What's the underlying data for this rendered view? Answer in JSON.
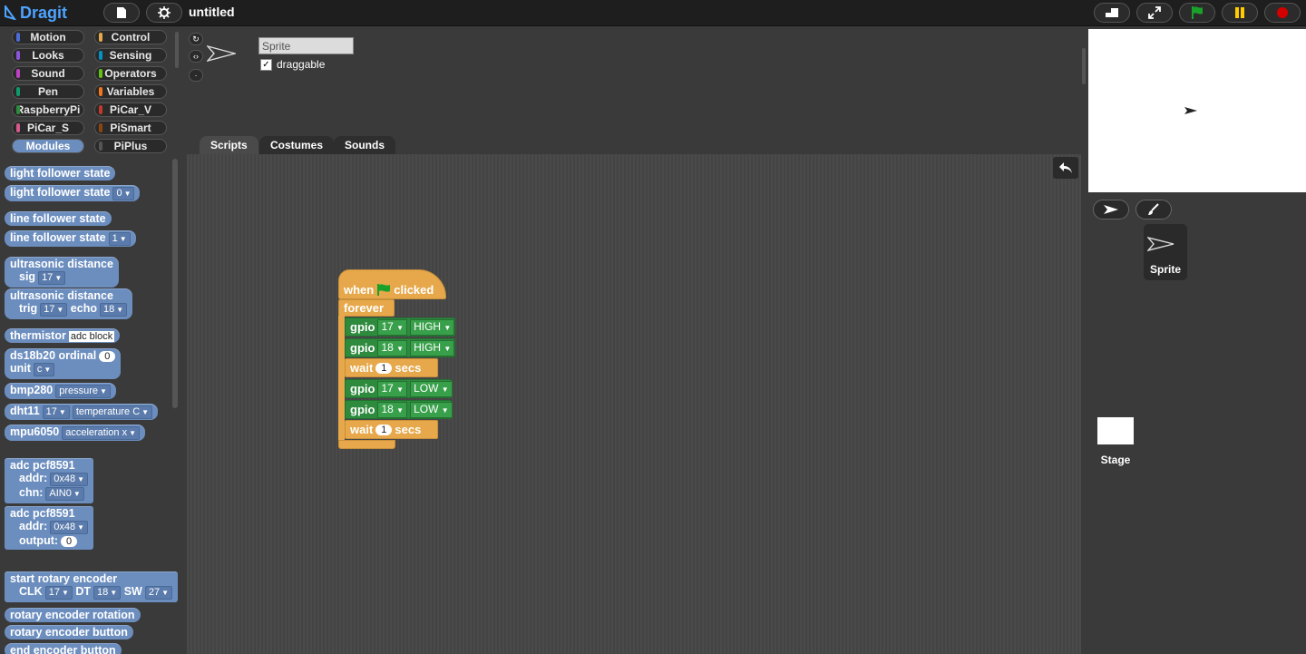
{
  "app": {
    "logo": "Dragit",
    "project_title": "untitled"
  },
  "categories": [
    {
      "label": "Motion",
      "color": "#4a6cd4"
    },
    {
      "label": "Control",
      "color": "#e6a84a"
    },
    {
      "label": "Looks",
      "color": "#8a55d7"
    },
    {
      "label": "Sensing",
      "color": "#0093c4"
    },
    {
      "label": "Sound",
      "color": "#bb42c3"
    },
    {
      "label": "Operators",
      "color": "#62c213"
    },
    {
      "label": "Pen",
      "color": "#0e9a6c"
    },
    {
      "label": "Variables",
      "color": "#f3761d"
    },
    {
      "label": "RaspberryPi",
      "color": "#2e8b3e"
    },
    {
      "label": "PiCar_V",
      "color": "#c0392b"
    },
    {
      "label": "PiCar_S",
      "color": "#d45a8a"
    },
    {
      "label": "PiSmart",
      "color": "#8b4513"
    },
    {
      "label": "Modules",
      "color": "#6c8ebf"
    },
    {
      "label": "PiPlus",
      "color": "#555555"
    }
  ],
  "palette": {
    "light_follower_state": "light follower state",
    "light_follower_state_n": "light follower state",
    "light_follower_n_val": "0",
    "line_follower_state": "line follower state",
    "line_follower_state_n": "line follower state",
    "line_follower_n_val": "1",
    "ultrasonic_1": "ultrasonic distance",
    "sig_label": "sig",
    "sig_val": "17",
    "ultrasonic_2": "ultrasonic distance",
    "trig_label": "trig",
    "trig_val": "17",
    "echo_label": "echo",
    "echo_val": "18",
    "thermistor": "thermistor",
    "thermistor_val": "adc block",
    "ds18b20": "ds18b20 ordinal",
    "ds18b20_val": "0",
    "unit_label": "unit",
    "unit_val": "c",
    "bmp280": "bmp280",
    "bmp280_val": "pressure",
    "dht11": "dht11",
    "dht11_pin": "17",
    "dht11_val": "temperature C",
    "mpu6050": "mpu6050",
    "mpu6050_val": "acceleration x",
    "adc1": "adc pcf8591",
    "addr_label": "addr:",
    "addr_val": "0x48",
    "chn_label": "chn:",
    "chn_val": "AIN0",
    "adc2": "adc pcf8591",
    "addr2_label": "addr:",
    "addr2_val": "0x48",
    "output_label": "output:",
    "output_val": "0",
    "rotary_start": "start rotary encoder",
    "clk_label": "CLK",
    "clk_val": "17",
    "dt_label": "DT",
    "dt_val": "18",
    "sw_label": "SW",
    "sw_val": "27",
    "rotary_rotation": "rotary encoder rotation",
    "rotary_button": "rotary encoder button",
    "rotary_cut": "end encoder button"
  },
  "sprite": {
    "name": "Sprite",
    "draggable_label": "draggable",
    "draggable_checked": "✓"
  },
  "tabs": [
    "Scripts",
    "Costumes",
    "Sounds"
  ],
  "script": {
    "hat_when": "when",
    "hat_clicked": "clicked",
    "forever": "forever",
    "rows": [
      {
        "type": "gpio",
        "label": "gpio",
        "pin": "17",
        "value": "HIGH"
      },
      {
        "type": "gpio",
        "label": "gpio",
        "pin": "18",
        "value": "HIGH"
      },
      {
        "type": "wait",
        "label": "wait",
        "value": "1",
        "unit": "secs"
      },
      {
        "type": "gpio",
        "label": "gpio",
        "pin": "17",
        "value": "LOW"
      },
      {
        "type": "gpio",
        "label": "gpio",
        "pin": "18",
        "value": "LOW"
      },
      {
        "type": "wait",
        "label": "wait",
        "value": "1",
        "unit": "secs"
      }
    ]
  },
  "corral": {
    "sprite_label": "Sprite",
    "stage_label": "Stage"
  }
}
